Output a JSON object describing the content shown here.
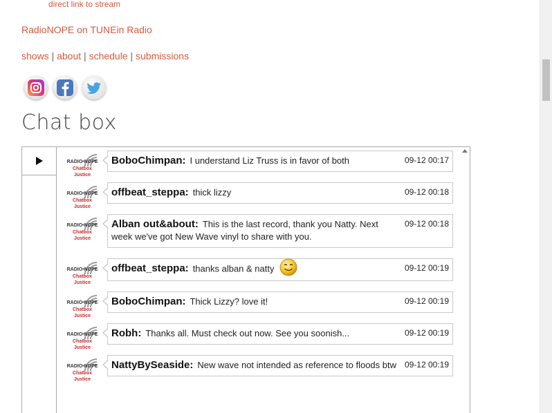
{
  "links": {
    "stream": "direct link to stream",
    "tunein": "RadioNOPE on TUNEin Radio"
  },
  "nav": {
    "items": [
      "shows",
      "about",
      "schedule",
      "submissions"
    ],
    "separator": "|"
  },
  "social": {
    "icons": [
      "instagram-icon",
      "facebook-icon",
      "twitter-icon"
    ]
  },
  "chat": {
    "heading": "Chat box",
    "avatar": {
      "top": "RADIO•NOPE",
      "mid": "Chatbox",
      "bot": "Justice"
    },
    "messages": [
      {
        "user": "BoboChimpan:",
        "text": "I understand Liz Truss is in favor of both",
        "time": "09-12 00:17"
      },
      {
        "user": "offbeat_steppa:",
        "text": "thick lizzy",
        "time": "09-12 00:18"
      },
      {
        "user": "Alban out&about:",
        "text": "This is the last record, thank you Natty. Next week we've got New Wave vinyl to share with you.",
        "time": "09-12 00:18"
      },
      {
        "user": "offbeat_steppa:",
        "text": "thanks alban & natty",
        "time": "09-12 00:19",
        "emoji": "smiley-icon"
      },
      {
        "user": "BoboChimpan:",
        "text": "Thick Lizzy? love it!",
        "time": "09-12 00:19"
      },
      {
        "user": "Robh:",
        "text": "Thanks all. Must check out now. See you soonish...",
        "time": "09-12 00:19"
      },
      {
        "user": "NattyBySeaside:",
        "text": "New wave not intended as reference to floods btw",
        "time": "09-12 00:19"
      }
    ]
  },
  "colors": {
    "link": "#d9583b",
    "text": "#222222",
    "heading": "#444444"
  }
}
